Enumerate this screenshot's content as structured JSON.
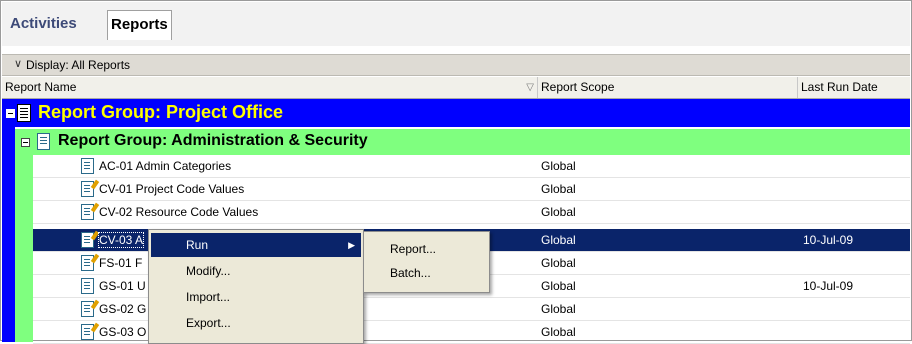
{
  "tabs": [
    {
      "label": "Activities",
      "active": false
    },
    {
      "label": "Reports",
      "active": true
    }
  ],
  "display_bar": {
    "label": "Display: All Reports"
  },
  "columns": {
    "name": "Report Name",
    "scope": "Report Scope",
    "last_run": "Last Run Date"
  },
  "group_project_office": {
    "title": "Report Group: Project Office",
    "bg_color": "#0000ff",
    "text_color": "#ffff00"
  },
  "group_admin": {
    "title": "Report Group: Administration & Security",
    "bg_color": "#7fff7f"
  },
  "rows": [
    {
      "name": "AC-01  Admin Categories",
      "scope": "Global",
      "date": ""
    },
    {
      "name": "CV-01  Project Code Values",
      "scope": "Global",
      "date": ""
    },
    {
      "name": "CV-02  Resource Code Values",
      "scope": "Global",
      "date": ""
    },
    {
      "name": "CV-03  A",
      "scope": "Global",
      "date": "10-Jul-09",
      "selected": true
    },
    {
      "name": "FS-01  F",
      "scope": "Global",
      "date": ""
    },
    {
      "name": "GS-01  U",
      "scope": "Global",
      "date": "10-Jul-09"
    },
    {
      "name": "GS-02  G",
      "scope": "Global",
      "date": ""
    },
    {
      "name": "GS-03  O",
      "scope": "Global",
      "date": ""
    }
  ],
  "context_menu": {
    "items": [
      "Run",
      "Modify...",
      "Import...",
      "Export..."
    ],
    "highlighted": "Run"
  },
  "submenu": {
    "items": [
      "Report...",
      "Batch..."
    ]
  },
  "colors": {
    "selection": "#0a246a",
    "menu_bg": "#ece9d8"
  }
}
